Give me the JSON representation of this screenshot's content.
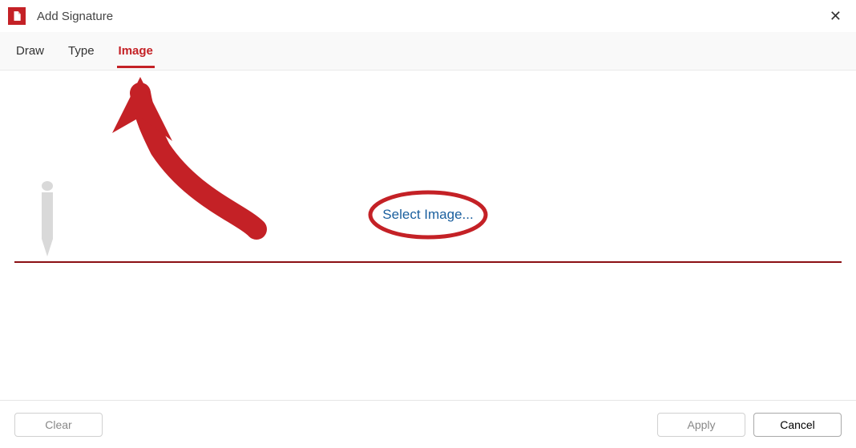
{
  "window": {
    "title": "Add Signature"
  },
  "tabs": {
    "draw": "Draw",
    "type": "Type",
    "image": "Image",
    "active": "image"
  },
  "main": {
    "select_image_label": "Select Image..."
  },
  "footer": {
    "clear": "Clear",
    "apply": "Apply",
    "cancel": "Cancel"
  },
  "colors": {
    "brand_red": "#c42126",
    "link_blue": "#1a5f9e"
  },
  "annotations": {
    "arrow_target": "tab-image",
    "circle_target": "select-image-link"
  }
}
